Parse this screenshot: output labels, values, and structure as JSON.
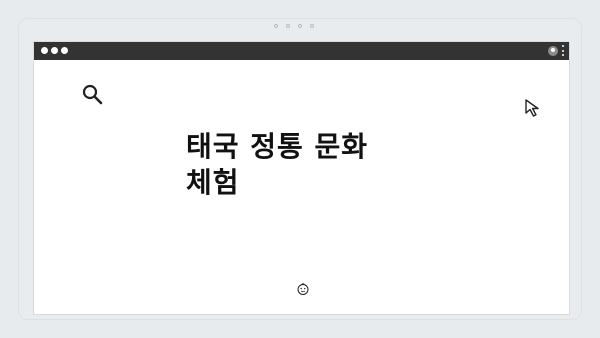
{
  "page": {
    "title_line1": "태국 정통 문화",
    "title_line2": "체험"
  },
  "icons": {
    "search": "search-icon",
    "cursor": "cursor-arrow-icon",
    "face": "smiley-face-icon",
    "profile": "profile-icon",
    "menu": "kebab-menu-icon"
  },
  "colors": {
    "title_bar": "#333333",
    "background": "#e8ebee",
    "content": "#ffffff",
    "text": "#111111"
  }
}
